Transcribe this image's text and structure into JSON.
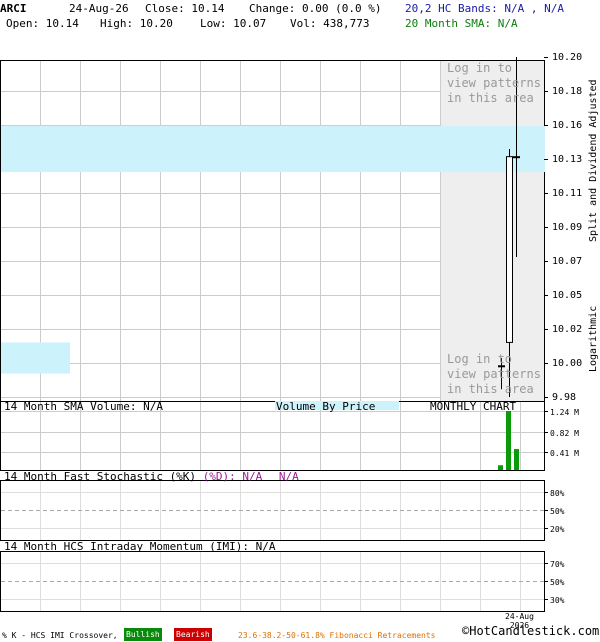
{
  "header": {
    "symbol": "ARCI",
    "date": "24-Aug-26",
    "close": "Close: 10.14",
    "change": "Change: 0.00 (0.0 %)",
    "open": "Open: 10.14",
    "high": "High: 10.20",
    "low": "Low: 10.07",
    "volume": "Vol: 438,773",
    "bands": "20,2 HC Bands: N/A , N/A",
    "sma": "20 Month SMA: N/A"
  },
  "colors": {
    "candle_up": "#ffffff",
    "volume_bar": "#0a9a0a",
    "band_fill": "#ccf3fb",
    "pattern_box": "#eeeeee",
    "bullish": "#0a8a0a",
    "bearish": "#cc0000",
    "fib": "#e07000"
  },
  "price_panel": {
    "pattern_top": "Log in to view patterns in this area",
    "pattern_bottom": "Log in to view patterns in this area",
    "adjusted_label": "Split and Dividend Adjusted",
    "scale_label": "Logarithmic"
  },
  "volume_panel": {
    "sma_label": "14 Month SMA Volume: N/A",
    "vbp_label": "Volume By Price",
    "chart_label": "MONTHLY CHART"
  },
  "stoch_panel": {
    "label_a": "14 Month Fast Stochastic (%K)",
    "label_b": "(%D): N/A",
    "label_c": "N/A",
    "ticks": [
      "80%",
      "50%",
      "20%"
    ]
  },
  "imi_panel": {
    "label": "14 Month HCS Intraday Momentum (IMI): N/A",
    "ticks": [
      "70%",
      "50%",
      "30%"
    ]
  },
  "footer": {
    "date_line1": "24-Aug",
    "date_line2": "2026",
    "legend_prefix": "% K - HCS IMI Crossover,",
    "bullish": "Bullish",
    "bearish": "Bearish",
    "fib": "23.6-38.2-50-61.8% Fibonacci Retracements",
    "brand": "©HotCandlestick.com"
  },
  "chart_data": [
    {
      "type": "candlestick",
      "title": "ARCI",
      "yscale": "log",
      "ylim": [
        9.98,
        10.2
      ],
      "yticks": [
        "10.20",
        "10.18",
        "10.16",
        "10.13",
        "10.11",
        "10.09",
        "10.07",
        "10.05",
        "10.02",
        "10.00",
        "9.98"
      ],
      "candles": [
        {
          "open": 10.0,
          "close": 10.0,
          "high": 10.005,
          "low": 9.985
        },
        {
          "open": 10.015,
          "close": 10.135,
          "high": 10.14,
          "low": 9.98
        },
        {
          "open": 10.135,
          "close": 10.135,
          "high": 10.2,
          "low": 10.07
        }
      ],
      "bands": [
        {
          "lower": 10.125,
          "upper": 10.155
        },
        {
          "lower": 9.995,
          "upper": 10.015
        }
      ]
    },
    {
      "type": "bar",
      "title": "Volume",
      "ylabel": "",
      "ylim": [
        0,
        1.24
      ],
      "yticks": [
        "1.24 M",
        "0.82 M",
        "0.41 M"
      ],
      "values": [
        0.1,
        1.24,
        0.44
      ]
    }
  ]
}
